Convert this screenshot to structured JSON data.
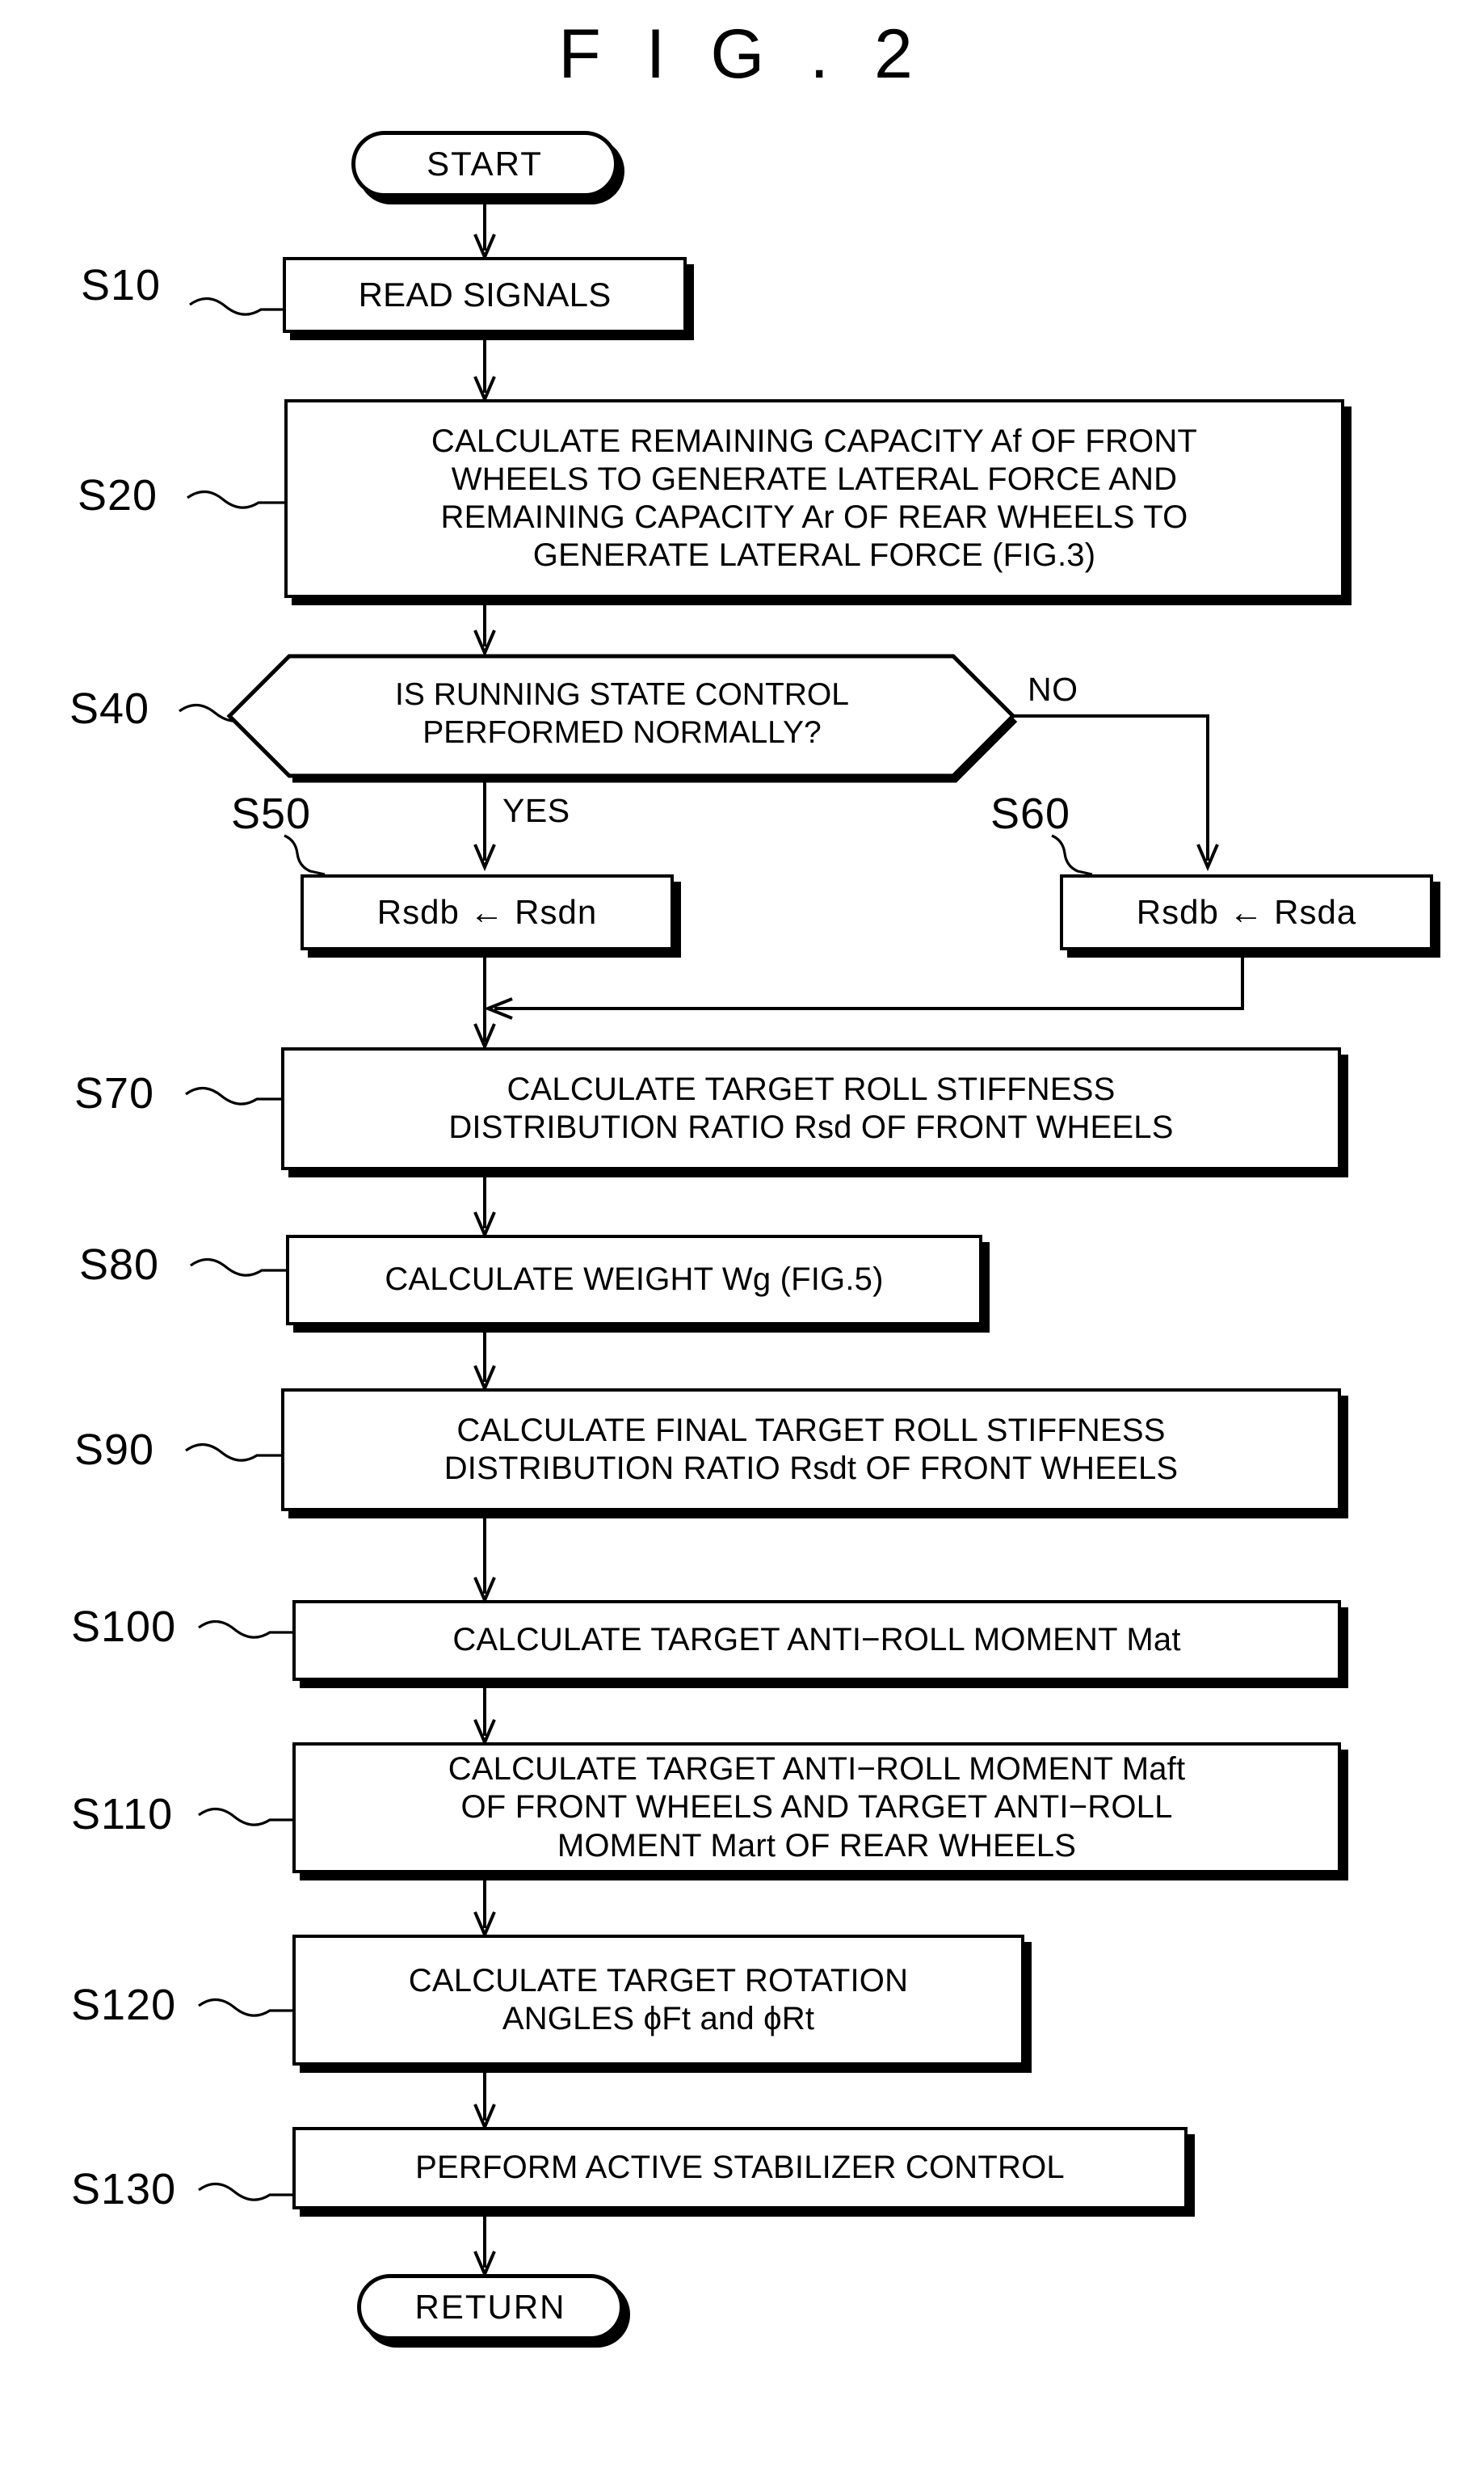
{
  "figure": {
    "title": "F I G . 2"
  },
  "nodes": {
    "start": {
      "label": "START",
      "shape": "terminal"
    },
    "s10": {
      "step": "S10",
      "label": "READ SIGNALS",
      "shape": "process"
    },
    "s20": {
      "step": "S20",
      "label": "CALCULATE REMAINING CAPACITY Af OF FRONT\nWHEELS TO GENERATE LATERAL FORCE AND\nREMAINING CAPACITY Ar OF REAR WHEELS TO\nGENERATE LATERAL FORCE (FIG.3)",
      "shape": "process"
    },
    "s40": {
      "step": "S40",
      "label": "IS RUNNING STATE CONTROL\nPERFORMED NORMALLY?",
      "shape": "decision"
    },
    "s50": {
      "step": "S50",
      "label": "Rsdb ← Rsdn",
      "shape": "process"
    },
    "s60": {
      "step": "S60",
      "label": "Rsdb ← Rsda",
      "shape": "process"
    },
    "s70": {
      "step": "S70",
      "label": "CALCULATE TARGET ROLL STIFFNESS\nDISTRIBUTION RATIO Rsd OF FRONT WHEELS",
      "shape": "process"
    },
    "s80": {
      "step": "S80",
      "label": "CALCULATE WEIGHT Wg (FIG.5)",
      "shape": "process"
    },
    "s90": {
      "step": "S90",
      "label": "CALCULATE FINAL TARGET ROLL STIFFNESS\nDISTRIBUTION RATIO Rsdt OF FRONT WHEELS",
      "shape": "process"
    },
    "s100": {
      "step": "S100",
      "label": "CALCULATE TARGET ANTI−ROLL MOMENT Mat",
      "shape": "process"
    },
    "s110": {
      "step": "S110",
      "label": "CALCULATE TARGET ANTI−ROLL MOMENT Maft\nOF FRONT WHEELS AND TARGET ANTI−ROLL\nMOMENT Mart OF REAR WHEELS",
      "shape": "process"
    },
    "s120": {
      "step": "S120",
      "label": "CALCULATE TARGET ROTATION\nANGLES  ϕFt and  ϕRt",
      "shape": "process"
    },
    "s130": {
      "step": "S130",
      "label": "PERFORM ACTIVE STABILIZER CONTROL",
      "shape": "process"
    },
    "return": {
      "label": "RETURN",
      "shape": "terminal"
    }
  },
  "branch_labels": {
    "no": "NO",
    "yes": "YES"
  },
  "colors": {
    "stroke": "#000000",
    "background": "#ffffff"
  }
}
